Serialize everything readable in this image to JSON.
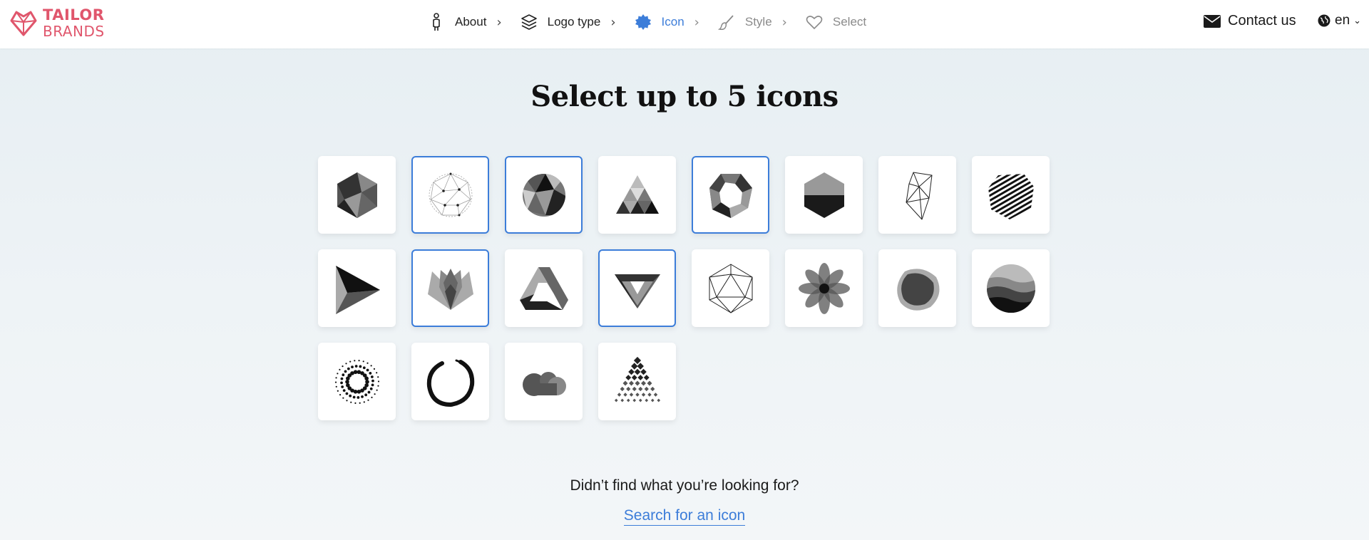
{
  "brand": {
    "line1": "TAILOR",
    "line2": "BRANDS",
    "color": "#e0566c"
  },
  "steps": [
    {
      "label": "About",
      "icon": "person-icon",
      "state": "done"
    },
    {
      "label": "Logo type",
      "icon": "layers-icon",
      "state": "done"
    },
    {
      "label": "Icon",
      "icon": "badge-icon",
      "state": "active"
    },
    {
      "label": "Style",
      "icon": "brush-icon",
      "state": "upcoming"
    },
    {
      "label": "Select",
      "icon": "heart-icon",
      "state": "upcoming"
    }
  ],
  "header": {
    "contact_label": "Contact us",
    "language": "en"
  },
  "page": {
    "title": "Select up to 5 icons",
    "not_found_text": "Didn’t find what you’re looking for?",
    "search_link": "Search for an icon"
  },
  "accent_color": "#3c7dd9",
  "icons": [
    {
      "name": "faceted-hexagon-icon",
      "selected": false
    },
    {
      "name": "dotted-network-sphere-icon",
      "selected": true
    },
    {
      "name": "faceted-circle-icon",
      "selected": true
    },
    {
      "name": "triangle-mosaic-icon",
      "selected": false
    },
    {
      "name": "faceted-ring-icon",
      "selected": true
    },
    {
      "name": "shaded-hexagon-icon",
      "selected": false
    },
    {
      "name": "wireframe-crystal-icon",
      "selected": false
    },
    {
      "name": "striped-polygon-icon",
      "selected": false
    },
    {
      "name": "play-triangle-icon",
      "selected": false
    },
    {
      "name": "lotus-icon",
      "selected": true
    },
    {
      "name": "impossible-triangle-icon",
      "selected": false
    },
    {
      "name": "diamond-gem-icon",
      "selected": true
    },
    {
      "name": "wireframe-icosahedron-icon",
      "selected": false
    },
    {
      "name": "flower-petals-icon",
      "selected": false
    },
    {
      "name": "overlapping-blobs-icon",
      "selected": false
    },
    {
      "name": "landscape-circle-icon",
      "selected": false
    },
    {
      "name": "dotted-ring-icon",
      "selected": false
    },
    {
      "name": "brush-circle-icon",
      "selected": false
    },
    {
      "name": "cloud-circles-icon",
      "selected": false
    },
    {
      "name": "dot-grid-fan-icon",
      "selected": false
    }
  ]
}
